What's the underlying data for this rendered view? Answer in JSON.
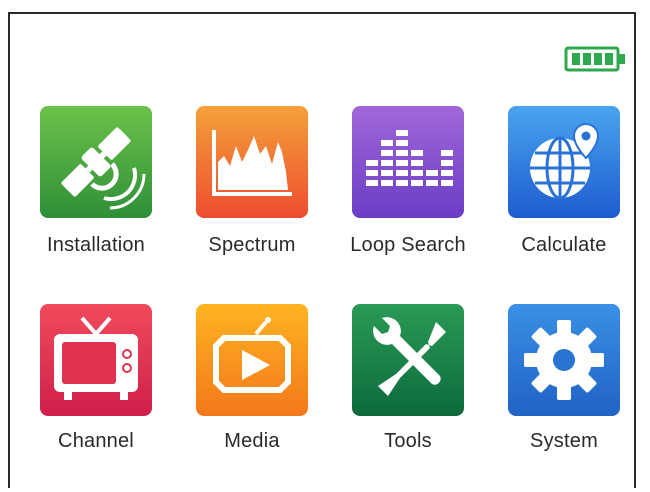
{
  "status_bar": {
    "battery_icon": "battery-full-icon",
    "battery_color": "#2fa84f"
  },
  "menu": {
    "items": [
      {
        "label": "Installation",
        "icon": "satellite-icon",
        "color_top": "#6cc24a",
        "color_bottom": "#2e8f37"
      },
      {
        "label": "Spectrum",
        "icon": "spectrum-chart-icon",
        "color_top": "#f6a13a",
        "color_bottom": "#ec4d2f"
      },
      {
        "label": "Loop Search",
        "icon": "equalizer-bars-icon",
        "color_top": "#a167d8",
        "color_bottom": "#6a3dc6"
      },
      {
        "label": "Calculate",
        "icon": "globe-pin-icon",
        "color_top": "#4aa4ef",
        "color_bottom": "#1d5ccf"
      },
      {
        "label": "Channel",
        "icon": "tv-icon",
        "color_top": "#f14a5a",
        "color_bottom": "#cf1f4c"
      },
      {
        "label": "Media",
        "icon": "media-play-icon",
        "color_top": "#ffb321",
        "color_bottom": "#f3781b"
      },
      {
        "label": "Tools",
        "icon": "wrench-screwdriver-icon",
        "color_top": "#2a9a56",
        "color_bottom": "#0d6a3c"
      },
      {
        "label": "System",
        "icon": "gear-icon",
        "color_top": "#3a8fe6",
        "color_bottom": "#2063c4"
      }
    ]
  }
}
